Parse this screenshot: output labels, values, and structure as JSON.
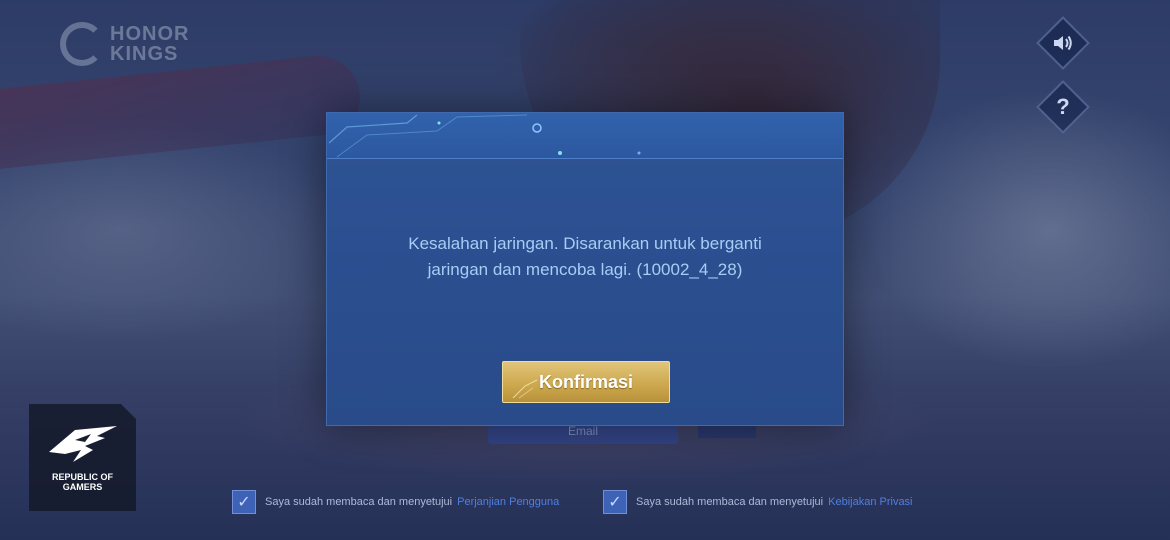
{
  "logo": {
    "line1": "HONOR",
    "line2": "KINGS"
  },
  "side_buttons": {
    "sound_icon": "speaker-icon",
    "help_label": "?"
  },
  "rog": {
    "line1": "REPUBLIC OF",
    "line2": "GAMERS"
  },
  "dialog": {
    "message_line1": "Kesalahan jaringan. Disarankan untuk berganti",
    "message_line2": "jaringan dan mencoba lagi. (10002_4_28)",
    "confirm_label": "Konfirmasi"
  },
  "behind": {
    "button_label": "Email"
  },
  "agreements": [
    {
      "text": "Saya sudah membaca dan menyetujui",
      "link": "Perjanjian Pengguna",
      "checked": true
    },
    {
      "text": "Saya sudah membaca dan menyetujui",
      "link": "Kebijakan Privasi",
      "checked": true
    }
  ],
  "colors": {
    "dialog_bg": "#2b4f90",
    "message_text": "#a6cdf5",
    "confirm_gold": "#cda94f",
    "link_blue": "#4f7fe0"
  }
}
